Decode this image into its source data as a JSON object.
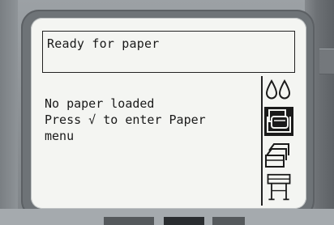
{
  "display": {
    "title": "Ready for paper",
    "message_lines": [
      "No paper loaded",
      "Press √ to enter Paper",
      "menu"
    ]
  },
  "side_icons": [
    {
      "name": "ink-drops-icon",
      "selected": false
    },
    {
      "name": "paper-tray-icon",
      "selected": true
    },
    {
      "name": "paper-stack-icon",
      "selected": false
    },
    {
      "name": "printer-stand-icon",
      "selected": false
    }
  ],
  "colors": {
    "lcd_background": "#f4f5f2",
    "lcd_ink": "#1a1a1a",
    "bezel": "#8f9498"
  }
}
